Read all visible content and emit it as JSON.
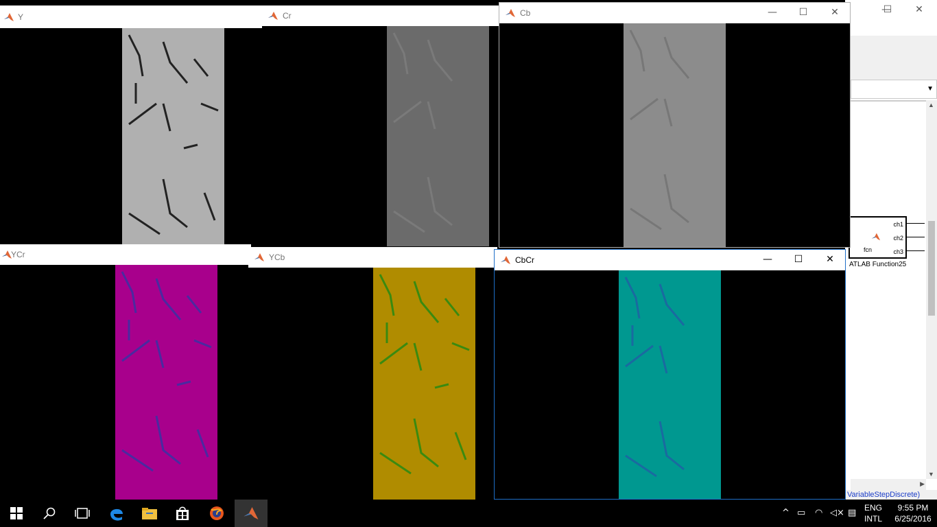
{
  "windows": {
    "y": {
      "title": "Y",
      "tint": "#b0b0b0"
    },
    "cr": {
      "title": "Cr",
      "tint": "#6b6b6b"
    },
    "cb": {
      "title": "Cb",
      "tint": "#8c8c8c"
    },
    "ycr": {
      "title": "YCr",
      "tint": "#a8008c"
    },
    "ycb": {
      "title": "YCb",
      "tint": "#b08c00"
    },
    "cbcr": {
      "title": "CbCr",
      "tint": "#009890"
    }
  },
  "simulink": {
    "ports": [
      "ch1",
      "ch2",
      "ch3"
    ],
    "fcn_label": "fcn",
    "block_label": "ATLAB Function25",
    "status_text": "VariableStepDiscrete)"
  },
  "taskbar": {
    "language": "ENG",
    "layout": "INTL",
    "time": "9:55 PM",
    "date": "6/25/2016"
  }
}
